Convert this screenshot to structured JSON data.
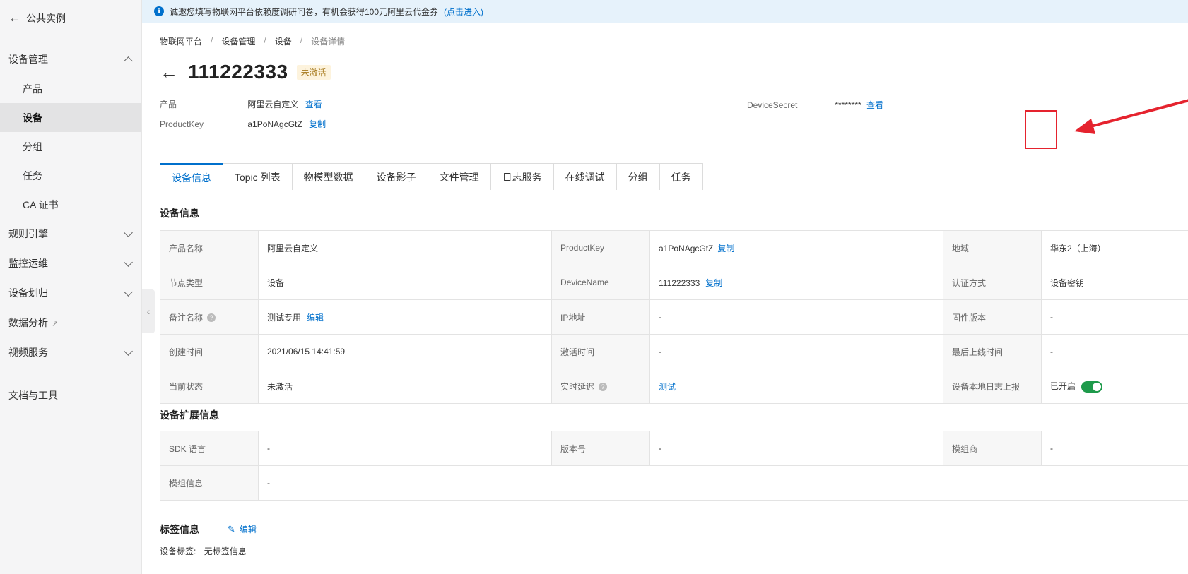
{
  "sidebar": {
    "back_label": "公共实例",
    "device_mgmt": "设备管理",
    "items": [
      "产品",
      "设备",
      "分组",
      "任务",
      "CA 证书"
    ],
    "rules_engine": "规则引擎",
    "monitoring": "监控运维",
    "device_assign": "设备划归",
    "data_analysis": "数据分析",
    "video_service": "视频服务",
    "docs_tools": "文档与工具"
  },
  "notice": {
    "text": "诚邀您填写物联网平台依赖度调研问卷，有机会获得100元阿里云代金券",
    "link": "(点击进入)"
  },
  "breadcrumb": [
    "物联网平台",
    "设备管理",
    "设备",
    "设备详情"
  ],
  "header": {
    "title": "111222333",
    "status": "未激活",
    "product_label": "产品",
    "product_value": "阿里云自定义",
    "product_link": "查看",
    "productkey_label": "ProductKey",
    "productkey_value": "a1PoNAgcGtZ",
    "productkey_link": "复制",
    "secret_label": "DeviceSecret",
    "secret_value": "********",
    "secret_link": "查看"
  },
  "tabs": [
    "设备信息",
    "Topic 列表",
    "物模型数据",
    "设备影子",
    "文件管理",
    "日志服务",
    "在线调试",
    "分组",
    "任务"
  ],
  "device_info": {
    "title": "设备信息",
    "rows": [
      [
        "产品名称",
        "阿里云自定义",
        "ProductKey",
        "a1PoNAgcGtZ",
        "地域",
        "华东2（上海）"
      ],
      [
        "节点类型",
        "设备",
        "DeviceName",
        "111222333",
        "认证方式",
        "设备密钥"
      ],
      [
        "备注名称",
        "测试专用",
        "IP地址",
        "-",
        "固件版本",
        "-"
      ],
      [
        "创建时间",
        "2021/06/15 14:41:59",
        "激活时间",
        "-",
        "最后上线时间",
        "-"
      ],
      [
        "当前状态",
        "未激活",
        "实时延迟",
        "测试",
        "设备本地日志上报",
        "已开启"
      ]
    ],
    "copy_label": "复制",
    "edit_label": "编辑",
    "log_report_enabled": true
  },
  "ext_info": {
    "title": "设备扩展信息",
    "rows": [
      [
        "SDK 语言",
        "-",
        "版本号",
        "-",
        "模组商",
        "-"
      ],
      [
        "模组信息",
        "-"
      ]
    ]
  },
  "tags": {
    "title": "标签信息",
    "edit_label": "编辑",
    "label": "设备标签:",
    "value": "无标签信息"
  },
  "colors": {
    "accent": "#0070cc",
    "annotation": "#e5232e",
    "toggle_on": "#1e9a4b"
  }
}
